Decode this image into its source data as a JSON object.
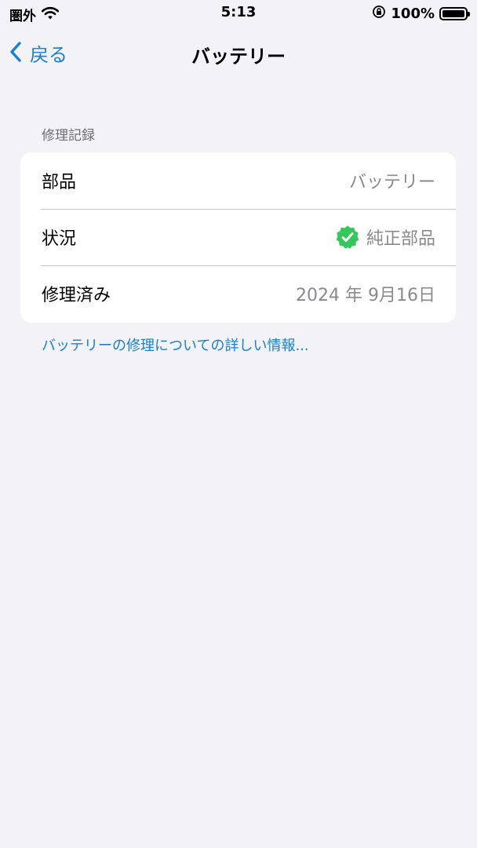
{
  "status_bar": {
    "carrier": "圏外",
    "time": "5:13",
    "battery_percent": "100%",
    "battery_level": 1.0
  },
  "nav": {
    "back_label": "戻る",
    "title": "バッテリー"
  },
  "section": {
    "header": "修理記録",
    "rows": [
      {
        "label": "部品",
        "value": "バッテリー"
      },
      {
        "label": "状況",
        "value": "純正部品",
        "icon": "verified-check-badge-icon",
        "icon_color": "#34c759"
      },
      {
        "label": "修理済み",
        "value": "2024 年 9月16日"
      }
    ]
  },
  "link": {
    "text": "バッテリーの修理についての詳しい情報..."
  },
  "colors": {
    "accent": "#1a7fd4",
    "background": "#f2f2f7",
    "secondary_text": "#8a8a8e",
    "verified": "#34c759"
  }
}
